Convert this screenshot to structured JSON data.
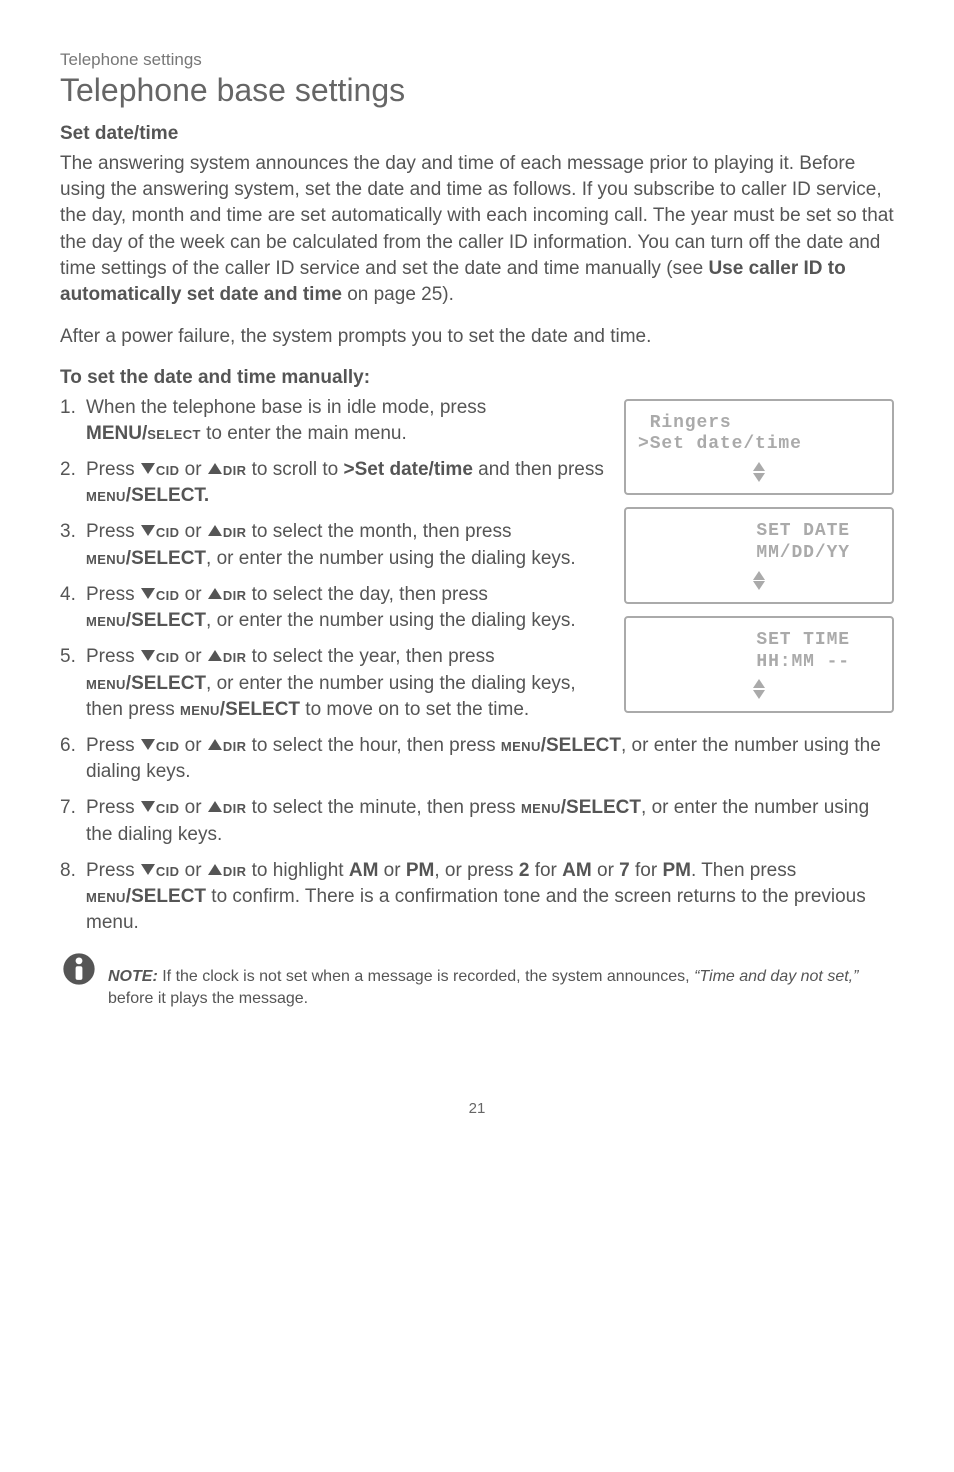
{
  "header": {
    "breadcrumb": "Telephone settings",
    "title": "Telephone base settings"
  },
  "section": {
    "heading": "Set date/time",
    "intro": "The answering system announces the day and time of each message prior to playing it. Before using the answering system, set the date and time as follows. If you subscribe to caller ID service, the day, month and time are set automatically with each incoming call. The year must be set so that the day of the week can be calculated from the caller ID information. You can turn off the date and time settings of the caller ID service and set the date and time manually (see ",
    "intro_bold": "Use caller ID to automatically set date and time",
    "intro_after": " on page 25).",
    "after_power": "After a power failure, the system prompts you to set the date and time.",
    "sub_heading": "To set the date and time manually:"
  },
  "labels": {
    "cid": "cid",
    "dir": "dir",
    "menu_select_sc": "menu/select",
    "menu_select_mixed_prefix": "menu",
    "menu_select_mixed_slash": "/SELECT",
    "menu_select_mixed_dot": "/SELECT.",
    "menu_select_mixed_comma": "/SELECT,"
  },
  "steps": {
    "s1a": "When the telephone base is in idle mode, press ",
    "s1b": "MENU/",
    "s1c": " to enter the main menu.",
    "select_sc": "select",
    "s2a": "Press ",
    "s2b": " or ",
    "s2c": " to scroll to ",
    "s2d": ">Set date/time",
    "s2e": " and then press ",
    "s3a": " to select the month, then press ",
    "s3b": " or enter the number using the dialing keys.",
    "s4a": " to select the day, then press ",
    "s5a": " to select the year, then press ",
    "s5b": " or enter the number using the dialing keys, then press ",
    "s5c": " to move on to set the time.",
    "s6a": " to select the hour, then press ",
    "s6b": " or enter the number using the dialing keys.",
    "s7a": " to select the minute, then press ",
    "s7b": " or enter the number using the dialing keys.",
    "s8a": " to highlight ",
    "s8_am": "AM",
    "s8_or1": " or ",
    "s8_pm": "PM",
    "s8b": ", or press ",
    "s8_2": "2",
    "s8c": " for ",
    "s8d": " or ",
    "s8_7": "7",
    "s8_for2": " for ",
    "s8e": ". Then press ",
    "s8f": " to confirm. There is a confirmation tone and the screen returns to the previous menu."
  },
  "lcd": {
    "box1_line1": " Ringers",
    "box1_line2": ">Set date/time",
    "box2_line1": "SET DATE",
    "box2_line2": "MM/DD/YY",
    "box3_line1": "SET TIME",
    "box3_line2": "HH:MM --"
  },
  "note": {
    "label": "NOTE:",
    "body1": " If the clock is not set when a message is recorded, the system announces, ",
    "quote": "“Time and day not set,”",
    "body2": " before it plays the message."
  },
  "page_number": "21"
}
